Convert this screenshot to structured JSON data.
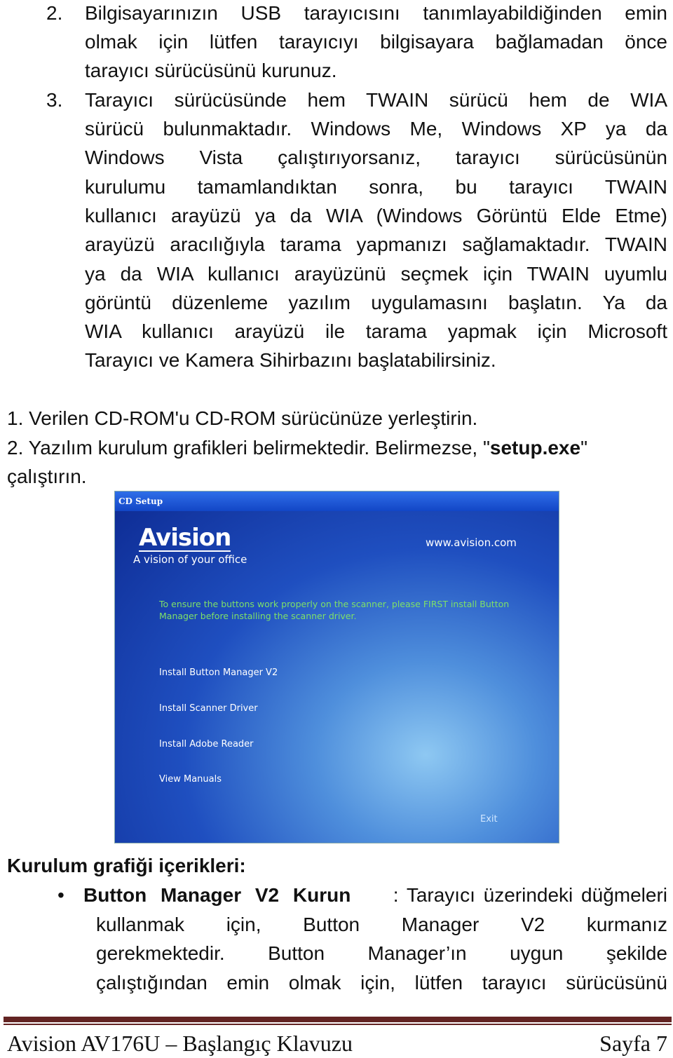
{
  "list_a": {
    "item2_number": "2.",
    "item2_lines": [
      "Bilgisayarınızın USB tarayıcısını tanımlayabildiğinden emin",
      "olmak için lütfen tarayıcıyı bilgisayara bağlamadan önce",
      "tarayıcı sürücüsünü kurunuz."
    ],
    "item3_number": "3.",
    "item3_lines": [
      "Tarayıcı sürücüsünde hem TWAIN sürücü hem de WIA",
      "sürücü bulunmaktadır. Windows Me, Windows XP ya da",
      "Windows Vista çalıştırıyorsanız, tarayıcı sürücüsünün",
      "kurulumu tamamlandıktan sonra, bu tarayıcı TWAIN",
      "kullanıcı arayüzü ya da WIA (Windows Görüntü Elde Etme)",
      "arayüzü aracılığıyla tarama yapmanızı sağlamaktadır. TWAIN",
      "ya da WIA kullanıcı arayüzünü seçmek için TWAIN uyumlu",
      "görüntü düzenleme yazılım uygulamasını başlatın. Ya da",
      "WIA kullanıcı arayüzü ile tarama yapmak için Microsoft",
      "Tarayıcı ve Kamera Sihirbazını başlatabilirsiniz."
    ]
  },
  "list_b": {
    "step1": "1. Verilen CD-ROM'u CD-ROM sürücünüze yerleştirin.",
    "step2_pre": "2. Yazılım kurulum grafikleri belirmektedir. Belirmezse, \"",
    "step2_bold": "setup.exe",
    "step2_post": "\"",
    "step2_line2": "çalıştırın."
  },
  "cd_setup": {
    "title": "CD Setup",
    "logo": "Avision",
    "tagline": "A vision of your office",
    "url": "www.avision.com",
    "warning": "To ensure the buttons work properly on the scanner, please FIRST install Button Manager before installing the scanner driver.",
    "menu": [
      "Install Button Manager V2",
      "Install Scanner Driver",
      "Install Adobe Reader",
      "View Manuals"
    ],
    "exit": "Exit"
  },
  "contents": {
    "heading": "Kurulum grafiği içerikleri:",
    "bullet_bold": "Button Manager V2 Kurun",
    "bullet_first_rest": ": Tarayıcı üzerindeki düğmeleri",
    "bullet_lines": [
      "kullanmak için, Button Manager V2 kurmanız",
      "gerekmektedir. Button Manager’ın uygun şekilde",
      "çalıştığından emin olmak için, lütfen tarayıcı sürücüsünü"
    ]
  },
  "footer": {
    "left": "Avision AV176U – Başlangıç Klavuzu",
    "right": "Sayfa 7"
  }
}
